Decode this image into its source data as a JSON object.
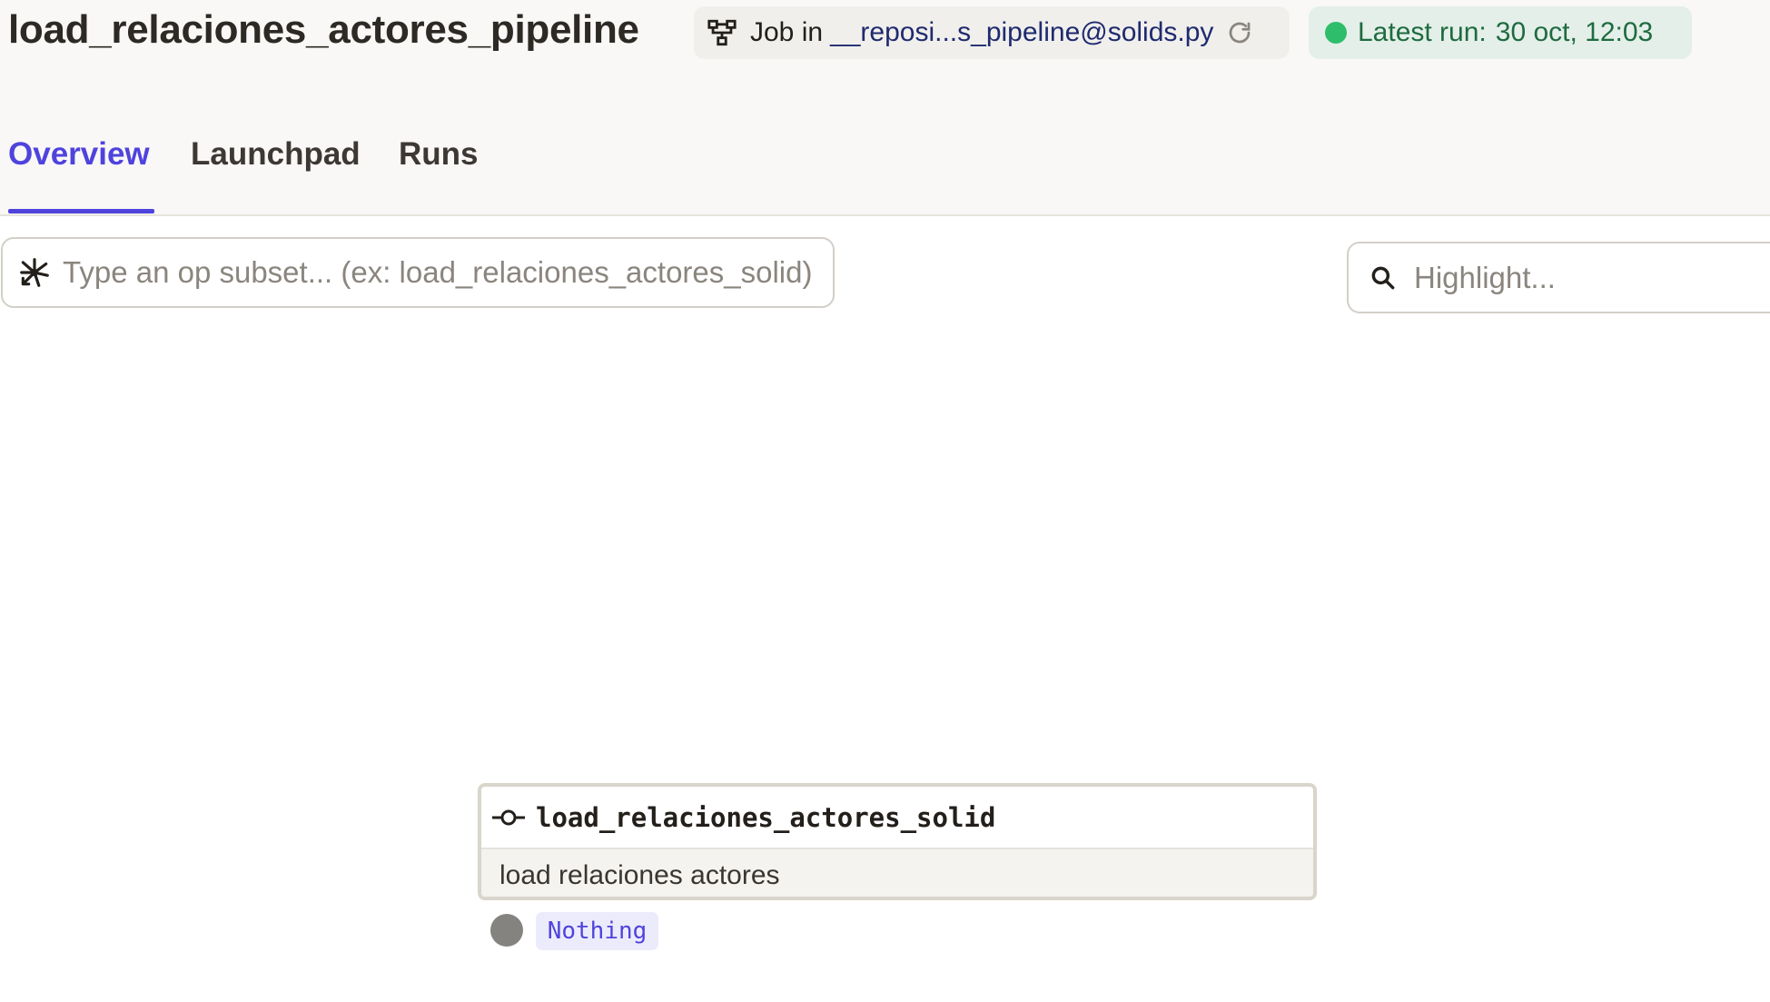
{
  "header": {
    "title": "load_relaciones_actores_pipeline",
    "job_tag": {
      "prefix": "Job in",
      "location": "__reposi...s_pipeline@solids.py",
      "icon": "job-graph-icon",
      "reload_icon": "reload-icon"
    },
    "latest_run": {
      "label": "Latest run:",
      "value": "30 oct, 12:03",
      "status_color": "#2ebd6b"
    }
  },
  "tabs": [
    {
      "label": "Overview",
      "active": true
    },
    {
      "label": "Launchpad",
      "active": false
    },
    {
      "label": "Runs",
      "active": false
    }
  ],
  "op_subset": {
    "placeholder": "Type an op subset... (ex: load_relaciones_actores_solid)",
    "value": ""
  },
  "highlight": {
    "placeholder": "Highlight...",
    "value": ""
  },
  "graph": {
    "op": {
      "name": "load_relaciones_actores_solid",
      "description": "load relaciones actores",
      "icon": "op-icon"
    },
    "output": {
      "type": "Nothing"
    }
  },
  "colors": {
    "accent": "#4f43dd",
    "success": "#2ebd6b"
  }
}
